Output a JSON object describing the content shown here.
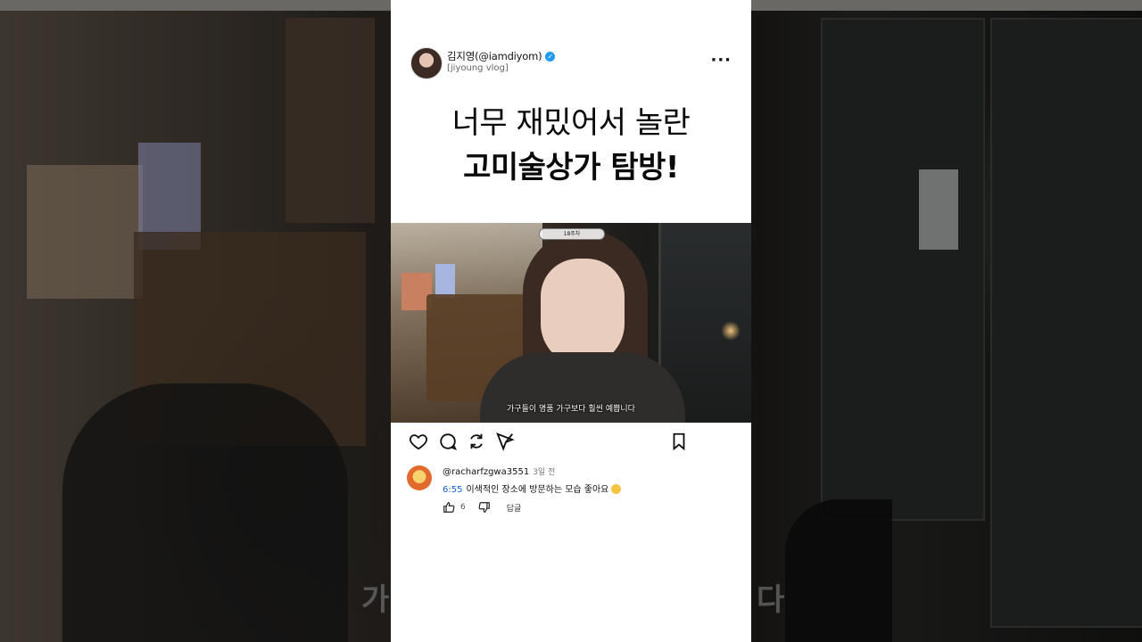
{
  "post": {
    "author_name": "김지영(@iamdiyom)",
    "author_sub": "[jiyoung vlog]",
    "more_label": "···",
    "headline_line1": "너무 재밌어서 놀란",
    "headline_line2": "고미술상가 탐방!"
  },
  "video": {
    "badge": "18주차",
    "caption": "가구들이 명품 가구보다 훨씬 예쁩니다"
  },
  "background": {
    "subtitle_left": "가",
    "subtitle_right": "다"
  },
  "comment": {
    "username": "@racharfzgwa3551",
    "time": "3일 전",
    "timestamp_link": "6:55",
    "text": "이색적인 장소에 방문하는 모습 좋아요",
    "like_count": "6",
    "reply_label": "답글"
  },
  "colors": {
    "verified": "#1d9bf0",
    "timestamp_link": "#1a5fd6"
  },
  "icons": [
    "heart-icon",
    "comment-icon",
    "repost-icon",
    "send-icon",
    "bookmark-icon",
    "thumbs-up-icon",
    "thumbs-down-icon",
    "verified-icon"
  ]
}
